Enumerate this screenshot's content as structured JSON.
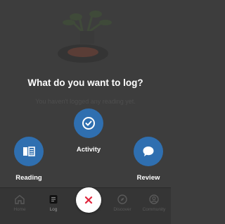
{
  "dialog": {
    "title": "What do you want to log?",
    "empty_message": "You haven't logged any reading yet."
  },
  "actions": [
    {
      "id": "activity",
      "label": "Activity",
      "icon": "check-badge-icon"
    },
    {
      "id": "reading",
      "label": "Reading",
      "icon": "book-icon"
    },
    {
      "id": "review",
      "label": "Review",
      "icon": "speech-bubble-icon"
    }
  ],
  "nav": {
    "items": [
      {
        "label": "Home",
        "icon": "home-icon"
      },
      {
        "label": "Log",
        "icon": "log-icon",
        "active": true
      },
      {
        "label": "Discover",
        "icon": "compass-icon"
      },
      {
        "label": "Community",
        "icon": "community-icon"
      }
    ],
    "close_icon": "close-icon"
  },
  "colors": {
    "overlay": "#3d3d3d",
    "accent": "#2f6fb0",
    "close": "#e0243b"
  }
}
